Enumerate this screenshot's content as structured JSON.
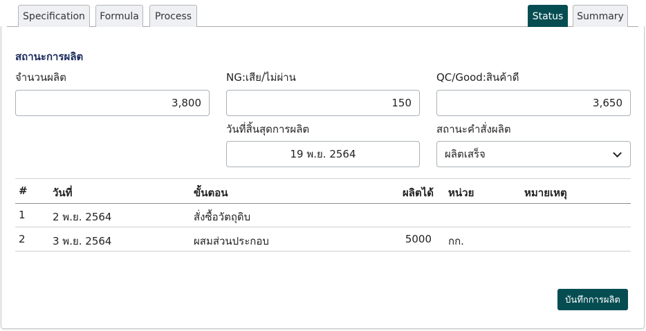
{
  "tabs": {
    "specification": "Specification",
    "formula": "Formula",
    "process": "Process",
    "status": "Status",
    "summary": "Summary"
  },
  "section_title": "สถานะการผลิต",
  "fields": {
    "production_qty": {
      "label": "จำนวนผลิต",
      "value": "3,800"
    },
    "ng_qty": {
      "label": "NG:เสีย/ไม่ผ่าน",
      "value": "150"
    },
    "good_qty": {
      "label": "QC/Good:สินค้าดี",
      "value": "3,650"
    },
    "end_date": {
      "label": "วันที่สิ้นสุดการผลิต",
      "value": "19 พ.ย. 2564"
    },
    "order_status": {
      "label": "สถานะคำสั่งผลิต",
      "value": "ผลิตเสร็จ"
    }
  },
  "table": {
    "headers": [
      "#",
      "วันที่",
      "ขั้นตอน",
      "ผลิตได้",
      "หน่วย",
      "หมายเหตุ"
    ],
    "rows": [
      [
        "1",
        "2 พ.ย. 2564",
        "สั่งซื้อวัตถุดิบ",
        "",
        "",
        ""
      ],
      [
        "2",
        "3 พ.ย. 2564",
        "ผสมส่วนประกอบ",
        "5000",
        "กก.",
        ""
      ]
    ]
  },
  "save_button": "บันทึกการผลิต"
}
